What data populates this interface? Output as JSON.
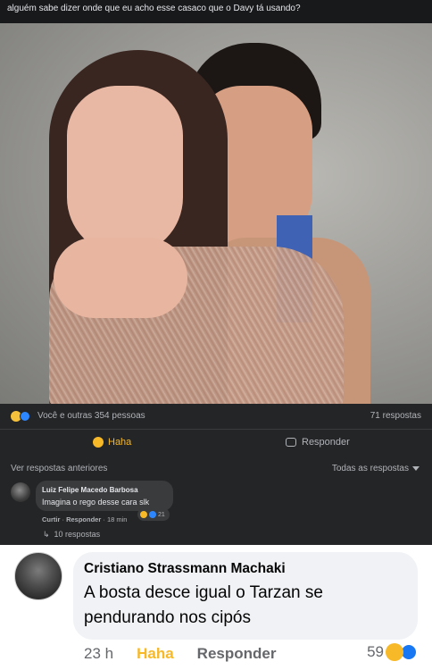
{
  "post": {
    "caption": "alguém sabe dizer onde que eu acho esse casaco que o Davy tá usando?",
    "reactions_text": "Você e outras 354 pessoas",
    "replies_count": "71 respostas",
    "haha_label": "Haha",
    "reply_label": "Responder"
  },
  "comments_section": {
    "older_link": "Ver respostas anteriores",
    "filter_label": "Todas as respostas"
  },
  "comment1": {
    "author": "Luiz Felipe Macedo Barbosa",
    "text": "Imagina o rego desse cara slk",
    "like_label": "Curtir",
    "reply_label": "Responder",
    "time": "18 min",
    "reaction_count": "21",
    "replies_link": "10 respostas"
  },
  "comment2": {
    "author": "Cristiano Strassmann Machaki",
    "text": "A bosta desce igual o Tarzan se pendurando nos cipós",
    "time": "23 h",
    "haha_label": "Haha",
    "reply_label": "Responder",
    "reaction_count": "59"
  },
  "colors": {
    "dark_bg": "#18191a",
    "panel_bg": "#242526",
    "haha_yellow": "#f7b928",
    "like_blue": "#1877f2"
  }
}
